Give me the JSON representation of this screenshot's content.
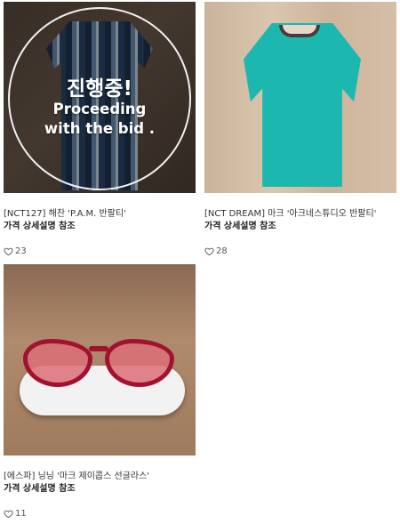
{
  "items": [
    {
      "overlay": {
        "status": "진행중!",
        "line1": "Proceeding",
        "line2": "with the bid ."
      },
      "title": "[NCT127] 해찬 'P.A.M. 반팔티'",
      "price": "가격 상세설명 참조",
      "likes": "23",
      "icon": "heart-outline-icon"
    },
    {
      "title": "[NCT DREAM] 마크 '아크네스튜디오 반팔티'",
      "price": "가격 상세설명 참조",
      "likes": "28",
      "icon": "heart-outline-icon"
    },
    {
      "title": "[에스파] 닝닝 '마크 제이콥스 선글라스'",
      "price": "가격 상세설명 참조",
      "likes": "11",
      "icon": "heart-outline-icon"
    }
  ]
}
